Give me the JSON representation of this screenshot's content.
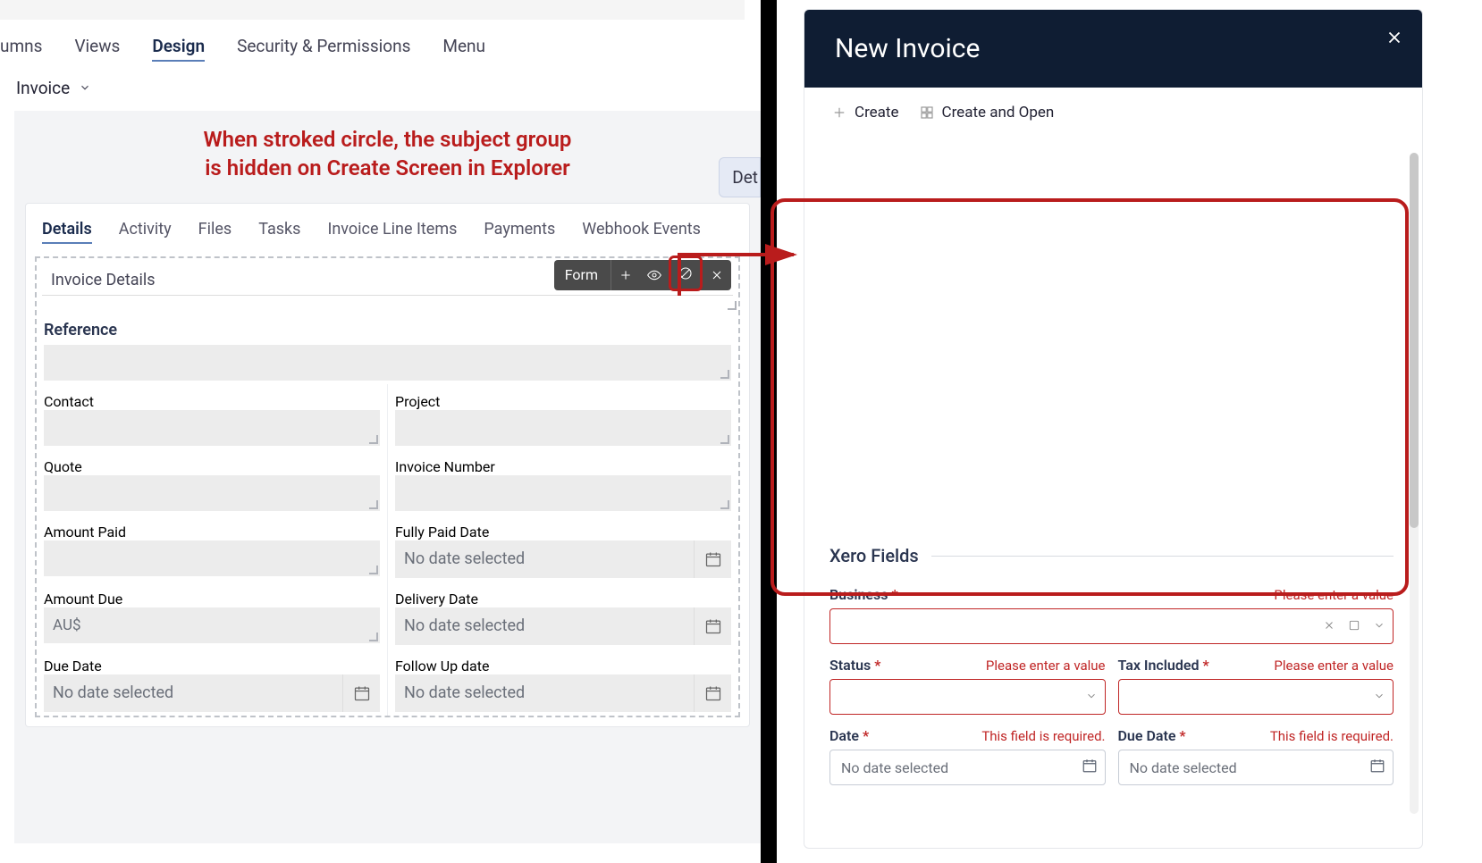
{
  "left": {
    "topTabs": [
      "umns",
      "Views",
      "Design",
      "Security & Permissions",
      "Menu"
    ],
    "topTabActive": "Design",
    "breadcrumb": "Invoice",
    "annotation_l1": "When stroked circle, the subject group",
    "annotation_l2": "is hidden on Create Screen in Explorer",
    "detBtn": "Det",
    "innerTabs": [
      "Details",
      "Activity",
      "Files",
      "Tasks",
      "Invoice Line Items",
      "Payments",
      "Webhook Events"
    ],
    "innerTabActive": "Details",
    "miniToolbar": {
      "label": "Form"
    },
    "groupTitle": "Invoice Details",
    "fields": {
      "reference": {
        "label": "Reference",
        "value": ""
      },
      "contact": {
        "label": "Contact",
        "value": ""
      },
      "project": {
        "label": "Project",
        "value": ""
      },
      "quote": {
        "label": "Quote",
        "value": ""
      },
      "invoiceNumber": {
        "label": "Invoice Number",
        "value": ""
      },
      "amountPaid": {
        "label": "Amount Paid",
        "value": ""
      },
      "fullyPaidDate": {
        "label": "Fully Paid Date",
        "value": "No date selected"
      },
      "amountDue": {
        "label": "Amount Due",
        "value": "AU$"
      },
      "deliveryDate": {
        "label": "Delivery Date",
        "value": "No date selected"
      },
      "dueDate": {
        "label": "Due Date",
        "value": "No date selected"
      },
      "followUpDate": {
        "label": "Follow Up date",
        "value": "No date selected"
      }
    }
  },
  "right": {
    "title": "New Invoice",
    "actions": {
      "create": "Create",
      "createOpen": "Create and Open"
    },
    "xeroSection": "Xero Fields",
    "fields": {
      "business": {
        "label": "Business",
        "err": "Please enter a value"
      },
      "status": {
        "label": "Status",
        "err": "Please enter a value"
      },
      "taxIncluded": {
        "label": "Tax Included",
        "err": "Please enter a value"
      },
      "date": {
        "label": "Date",
        "err": "This field is required.",
        "value": "No date selected"
      },
      "dueDate": {
        "label": "Due Date",
        "err": "This field is required.",
        "value": "No date selected"
      }
    }
  }
}
